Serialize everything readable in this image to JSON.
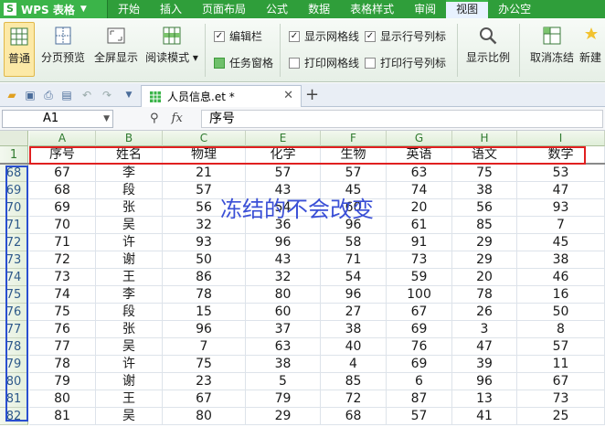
{
  "app": {
    "name": "WPS 表格",
    "logo_letter": "S"
  },
  "menu": [
    "开始",
    "插入",
    "页面布局",
    "公式",
    "数据",
    "表格样式",
    "审阅",
    "视图",
    "办公空"
  ],
  "ribbon": {
    "normal": "普通",
    "page_break_preview": "分页预览",
    "full_screen": "全屏显示",
    "reading_mode": "阅读模式",
    "edit_bar": "编辑栏",
    "task_pane": "任务窗格",
    "show_gridlines": "显示网格线",
    "print_gridlines": "打印网格线",
    "show_row_col_headers": "显示行号列标",
    "print_row_col_headers": "打印行号列标",
    "zoom": "显示比例",
    "unfreeze": "取消冻结",
    "new_window": "新建"
  },
  "tab": {
    "title": "人员信息.et *"
  },
  "formula": {
    "cell_ref": "A1",
    "fx": "fx",
    "value": "序号"
  },
  "columns": [
    "A",
    "B",
    "C",
    "E",
    "F",
    "G",
    "H",
    "I"
  ],
  "header_row": {
    "row_label": "1",
    "cells": [
      "序号",
      "姓名",
      "物理",
      "化学",
      "生物",
      "英语",
      "语文",
      "数学"
    ]
  },
  "rows": [
    {
      "row_label": "68",
      "cells": [
        "67",
        "李",
        "21",
        "57",
        "57",
        "63",
        "75",
        "53"
      ]
    },
    {
      "row_label": "69",
      "cells": [
        "68",
        "段",
        "57",
        "43",
        "45",
        "74",
        "38",
        "47"
      ]
    },
    {
      "row_label": "70",
      "cells": [
        "69",
        "张",
        "56",
        "54",
        "60",
        "20",
        "56",
        "93"
      ]
    },
    {
      "row_label": "71",
      "cells": [
        "70",
        "吴",
        "32",
        "36",
        "96",
        "61",
        "85",
        "7"
      ]
    },
    {
      "row_label": "72",
      "cells": [
        "71",
        "许",
        "93",
        "96",
        "58",
        "91",
        "29",
        "45"
      ]
    },
    {
      "row_label": "73",
      "cells": [
        "72",
        "谢",
        "50",
        "43",
        "71",
        "73",
        "29",
        "38"
      ]
    },
    {
      "row_label": "74",
      "cells": [
        "73",
        "王",
        "86",
        "32",
        "54",
        "59",
        "20",
        "46"
      ]
    },
    {
      "row_label": "75",
      "cells": [
        "74",
        "李",
        "78",
        "80",
        "96",
        "100",
        "78",
        "16"
      ]
    },
    {
      "row_label": "76",
      "cells": [
        "75",
        "段",
        "15",
        "60",
        "27",
        "67",
        "26",
        "50"
      ]
    },
    {
      "row_label": "77",
      "cells": [
        "76",
        "张",
        "96",
        "37",
        "38",
        "69",
        "3",
        "8"
      ]
    },
    {
      "row_label": "78",
      "cells": [
        "77",
        "吴",
        "7",
        "63",
        "40",
        "76",
        "47",
        "57"
      ]
    },
    {
      "row_label": "79",
      "cells": [
        "78",
        "许",
        "75",
        "38",
        "4",
        "69",
        "39",
        "11"
      ]
    },
    {
      "row_label": "80",
      "cells": [
        "79",
        "谢",
        "23",
        "5",
        "85",
        "6",
        "96",
        "67"
      ]
    },
    {
      "row_label": "81",
      "cells": [
        "80",
        "王",
        "67",
        "79",
        "72",
        "87",
        "13",
        "73"
      ]
    },
    {
      "row_label": "82",
      "cells": [
        "81",
        "吴",
        "80",
        "29",
        "68",
        "57",
        "41",
        "25"
      ]
    }
  ],
  "annotation": "冻结的不会改变",
  "colors": {
    "menubar": "#2f9e3a",
    "red_box": "#e02020",
    "blue_box": "#2a4fd0",
    "annotation": "#3a4fd6"
  }
}
